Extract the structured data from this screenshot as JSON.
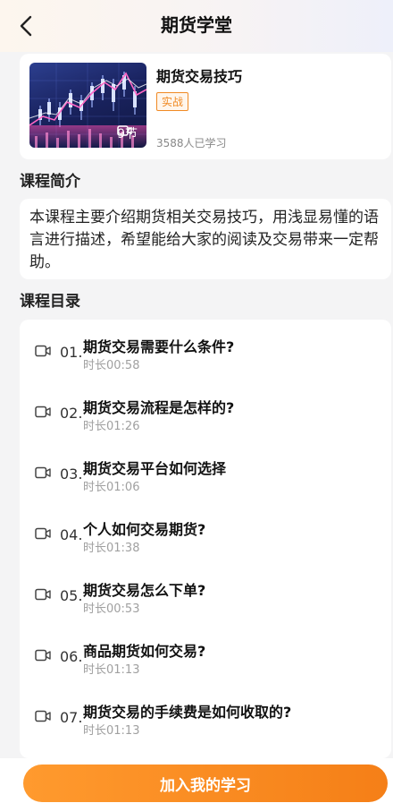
{
  "header": {
    "title": "期货学堂"
  },
  "course": {
    "name": "期货交易技巧",
    "tag": "实战",
    "lesson_count": "9节",
    "learners": "3588人已学习",
    "accent_color": "#f08a24"
  },
  "intro": {
    "heading": "课程简介",
    "text": "本课程主要介绍期货相关交易技巧，用浅显易懂的语言进行描述，希望能给大家的阅读及交易带来一定帮助。"
  },
  "catalog": {
    "heading": "课程目录",
    "lessons": [
      {
        "num": "01.",
        "title": "期货交易需要什么条件?",
        "duration": "时长00:58"
      },
      {
        "num": "02.",
        "title": "期货交易流程是怎样的?",
        "duration": "时长01:26"
      },
      {
        "num": "03.",
        "title": "期货交易平台如何选择",
        "duration": "时长01:06"
      },
      {
        "num": "04.",
        "title": "个人如何交易期货?",
        "duration": "时长01:38"
      },
      {
        "num": "05.",
        "title": "期货交易怎么下单?",
        "duration": "时长00:53"
      },
      {
        "num": "06.",
        "title": "商品期货如何交易?",
        "duration": "时长01:13"
      },
      {
        "num": "07.",
        "title": "期货交易的手续费是如何收取的?",
        "duration": "时长01:13"
      }
    ]
  },
  "footer": {
    "join_label": "加入我的学习",
    "button_color": "#f7861f"
  }
}
